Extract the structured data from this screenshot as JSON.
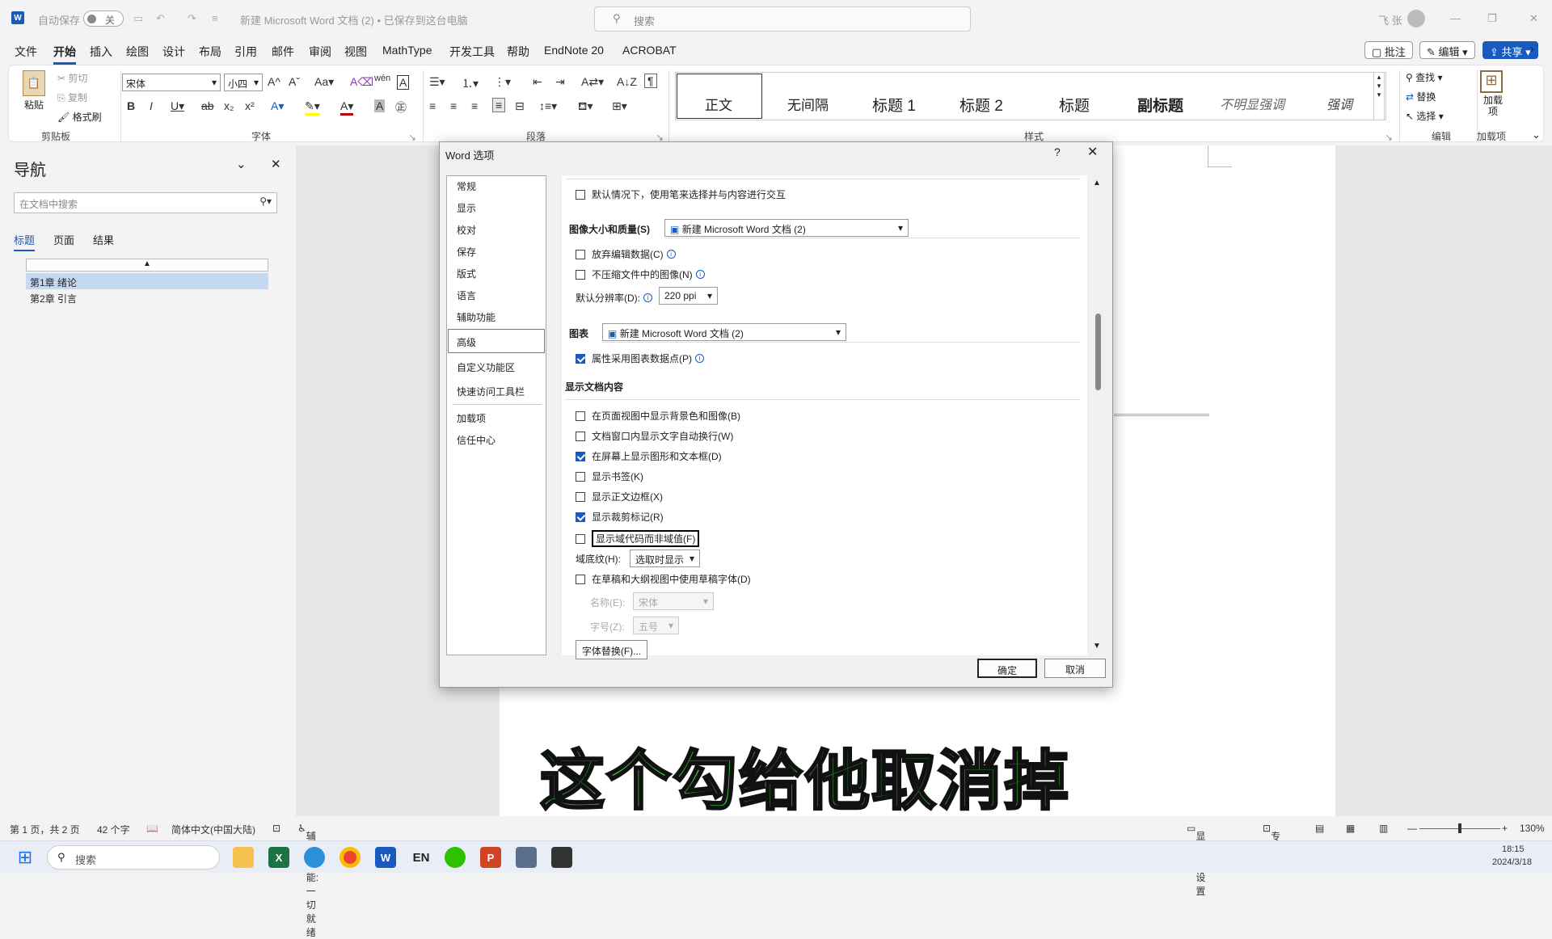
{
  "titlebar": {
    "autosave": "自动保存",
    "toggle": "关",
    "doc_title": "新建 Microsoft Word 文档 (2) • 已保存到这台电脑",
    "search": "搜索",
    "user": "飞 张"
  },
  "menu": [
    "文件",
    "开始",
    "插入",
    "绘图",
    "设计",
    "布局",
    "引用",
    "邮件",
    "审阅",
    "视图",
    "MathType",
    "开发工具",
    "帮助",
    "EndNote 20",
    "ACROBAT"
  ],
  "menu_right": {
    "comment": "批注",
    "edit": "编辑",
    "share": "共享"
  },
  "ribbon": {
    "clipboard": {
      "paste": "粘贴",
      "cut": "剪切",
      "copy": "复制",
      "painter": "格式刷",
      "group": "剪贴板"
    },
    "font": {
      "name": "宋体",
      "size": "小四",
      "group": "字体"
    },
    "paragraph": {
      "group": "段落"
    },
    "styles": {
      "items": [
        "正文",
        "无间隔",
        "标题 1",
        "标题 2",
        "标题",
        "副标题",
        "不明显强调",
        "强调"
      ],
      "group": "样式"
    },
    "editing": {
      "find": "查找",
      "replace": "替换",
      "select": "选择",
      "group": "编辑"
    },
    "addins": {
      "label": "加载项",
      "group": "加载项"
    }
  },
  "nav": {
    "title": "导航",
    "search_placeholder": "在文档中搜索",
    "tabs": [
      "标题",
      "页面",
      "结果"
    ],
    "headings": [
      "第1章 绪论",
      "第2章 引言"
    ]
  },
  "dialog": {
    "title": "Word 选项",
    "help": "?",
    "sidebar": [
      "常规",
      "显示",
      "校对",
      "保存",
      "版式",
      "语言",
      "辅助功能",
      "高级",
      "自定义功能区",
      "快速访问工具栏",
      "加载项",
      "信任中心"
    ],
    "selected": "高级",
    "pen_option": "默认情况下，使用笔来选择并与内容进行交互",
    "image_section": "图像大小和质量(S)",
    "image_doc": "新建 Microsoft Word 文档 (2)",
    "discard_edit": "放弃编辑数据(C)",
    "no_compress": "不压缩文件中的图像(N)",
    "resolution_label": "默认分辨率(D):",
    "resolution_value": "220 ppi",
    "chart_section": "图表",
    "chart_doc": "新建 Microsoft Word 文档 (2)",
    "chart_attr": "属性采用图表数据点(P)",
    "display_section": "显示文档内容",
    "options": [
      {
        "label": "在页面视图中显示背景色和图像(B)",
        "checked": false
      },
      {
        "label": "文档窗口内显示文字自动换行(W)",
        "checked": false
      },
      {
        "label": "在屏幕上显示图形和文本框(D)",
        "checked": true
      },
      {
        "label": "显示书签(K)",
        "checked": false
      },
      {
        "label": "显示正文边框(X)",
        "checked": false
      },
      {
        "label": "显示裁剪标记(R)",
        "checked": true
      },
      {
        "label": "显示域代码而非域值(F)",
        "checked": false
      }
    ],
    "field_shading_label": "域底纹(H):",
    "field_shading_value": "选取时显示",
    "draft_font": "在草稿和大纲视图中使用草稿字体(D)",
    "name_label": "名称(E):",
    "name_value": "宋体",
    "size_label": "字号(Z):",
    "size_value": "五号",
    "font_sub": "字体替换(F)...",
    "ok": "确定",
    "cancel": "取消"
  },
  "caption": "这个勾给他取消掉",
  "status": {
    "page": "第 1 页，共 2 页",
    "words": "42 个字",
    "lang": "简体中文(中国大陆)",
    "access": "辅助功能: 一切就绪",
    "display": "显示器设置",
    "focus": "专注",
    "zoom": "130%"
  },
  "taskbar": {
    "search": "搜索",
    "time": "18:15",
    "date": "2024/3/18"
  }
}
